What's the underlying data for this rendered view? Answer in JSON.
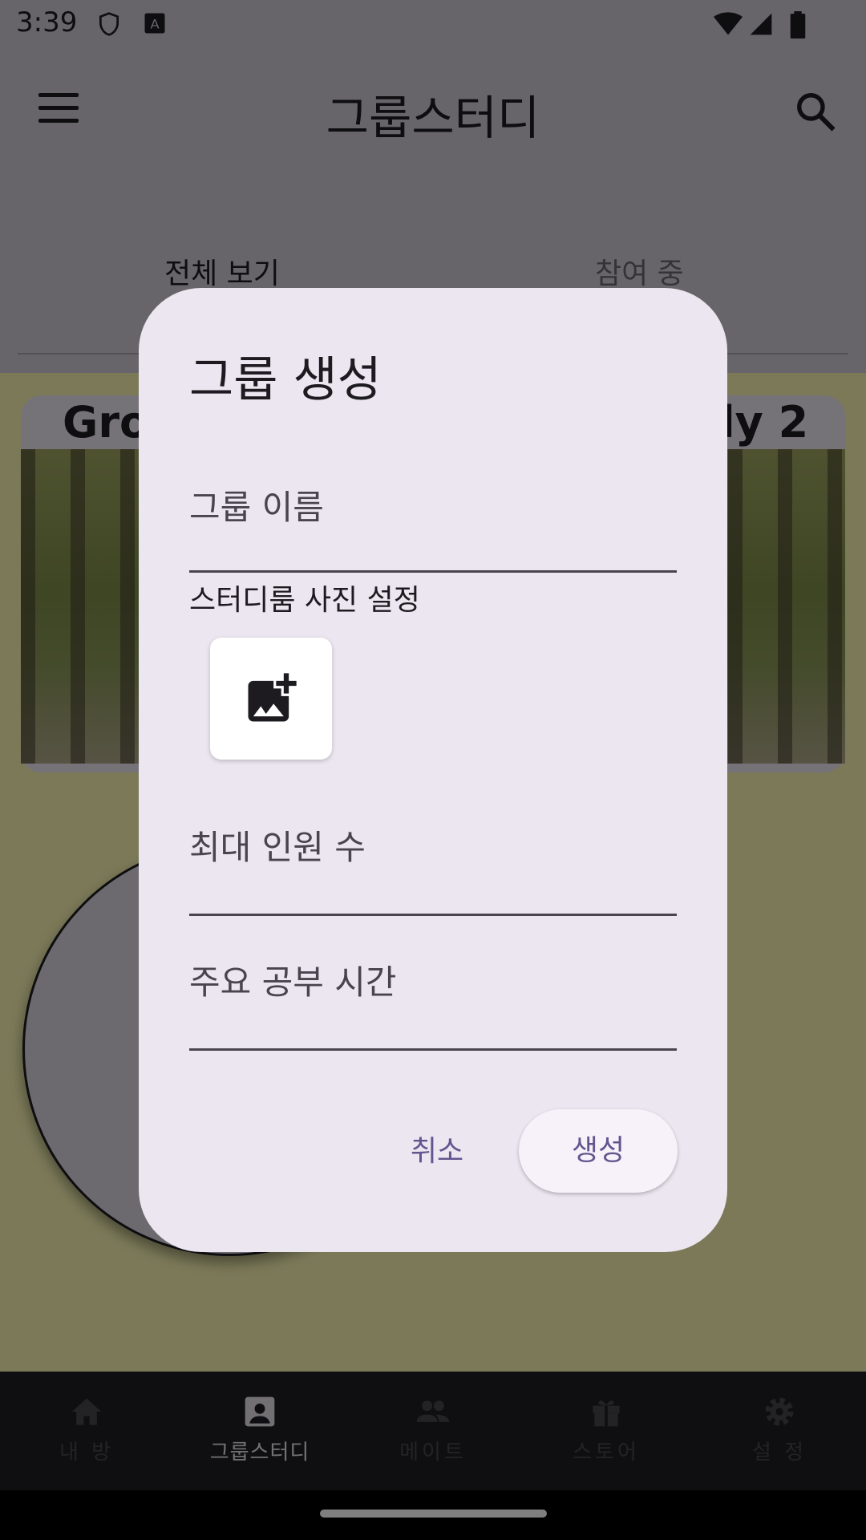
{
  "status_bar": {
    "time": "3:39"
  },
  "app_bar": {
    "title": "그룹스터디"
  },
  "tabs": [
    {
      "label": "전체 보기",
      "selected": true
    },
    {
      "label": "참여 중",
      "selected": false
    }
  ],
  "cards": [
    {
      "title": "Gro"
    },
    {
      "title": "dy 2"
    }
  ],
  "bottom_nav": [
    {
      "label": "내 방",
      "icon": "home-icon",
      "active": false
    },
    {
      "label": "그룹스터디",
      "icon": "account-box-icon",
      "active": true
    },
    {
      "label": "메이트",
      "icon": "people-icon",
      "active": false
    },
    {
      "label": "스토어",
      "icon": "gift-icon",
      "active": false
    },
    {
      "label": "설 정",
      "icon": "gear-icon",
      "active": false
    }
  ],
  "dialog": {
    "title": "그룹 생성",
    "group_name_placeholder": "그룹 이름",
    "photo_label": "스터디룸 사진 설정",
    "max_members_placeholder": "최대 인원 수",
    "study_time_placeholder": "주요 공부 시간",
    "cancel_label": "취소",
    "create_label": "생성"
  },
  "colors": {
    "dialog_bg": "#ece6f0",
    "accent": "#65558f",
    "content_bg": "#f6f2b0"
  }
}
